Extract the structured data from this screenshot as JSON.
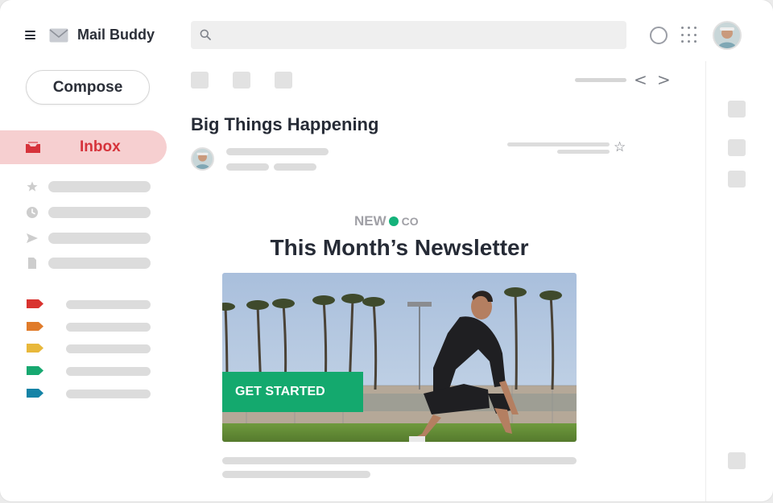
{
  "app": {
    "title": "Mail Buddy"
  },
  "header": {
    "menu_icon": "hamburger-menu-icon",
    "logo_icon": "envelope-icon",
    "search_icon": "search-icon",
    "status_icon": "circle-icon",
    "apps_icon": "apps-grid-icon"
  },
  "sidebar": {
    "compose_label": "Compose",
    "inbox_label": "Inbox",
    "nav_icons": [
      "star-icon",
      "clock-icon",
      "send-icon",
      "document-icon"
    ],
    "label_colors": [
      "#d9332f",
      "#e07b2a",
      "#e8b83b",
      "#17a870",
      "#1483a6"
    ]
  },
  "message": {
    "subject": "Big Things Happening",
    "brand_new": "NEW",
    "brand_co": "CO",
    "headline": "This Month’s Newsletter",
    "cta_label": "GET STARTED"
  },
  "colors": {
    "accent": "#d6333b",
    "inbox_bg": "#f6cfd0",
    "brand_green": "#14a96e"
  }
}
